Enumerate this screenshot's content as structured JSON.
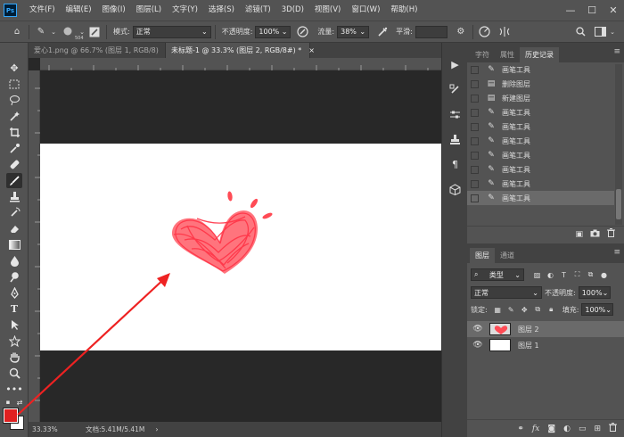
{
  "app": {
    "logo": "Ps"
  },
  "menu": [
    "文件(F)",
    "编辑(E)",
    "图像(I)",
    "图层(L)",
    "文字(Y)",
    "选择(S)",
    "滤镜(T)",
    "3D(D)",
    "视图(V)",
    "窗口(W)",
    "帮助(H)"
  ],
  "window_controls": {
    "minimize": "—",
    "maximize": "☐",
    "close": "✕"
  },
  "options": {
    "brush_size": "504",
    "mode_label": "模式:",
    "mode_value": "正常",
    "opacity_label": "不透明度:",
    "opacity_value": "100%",
    "flow_label": "流量:",
    "flow_value": "38%",
    "smooth_label": "平滑:"
  },
  "doc_tabs": [
    {
      "label": "爱心1.png @ 66.7% (图层 1, RGB/8)",
      "close": "×"
    },
    {
      "label": "未标题-1 @ 33.3% (图层 2, RGB/8#) *",
      "close": "×"
    }
  ],
  "status": {
    "zoom": "33.33%",
    "doc": "文档:5.41M/5.41M",
    "arrow": "›"
  },
  "history_panel": {
    "tabs": [
      "字符",
      "属性",
      "历史记录"
    ],
    "items": [
      "画笔工具",
      "删除图层",
      "新建图层",
      "画笔工具",
      "画笔工具",
      "画笔工具",
      "画笔工具",
      "画笔工具",
      "画笔工具",
      "画笔工具"
    ],
    "item_icons": [
      "brush-icon",
      "doc-icon",
      "doc-icon",
      "brush-icon",
      "brush-icon",
      "brush-icon",
      "brush-icon",
      "brush-icon",
      "brush-icon",
      "brush-icon"
    ]
  },
  "layers_panel": {
    "tabs": [
      "图层",
      "通道"
    ],
    "filter_value": "类型",
    "blend_value": "正常",
    "opacity_label": "不透明度:",
    "opacity_value": "100%",
    "lock_label": "锁定:",
    "fill_label": "填充:",
    "fill_value": "100%",
    "layers": [
      "图层 2",
      "图层 1"
    ]
  },
  "colors": {
    "foreground": "#e02020",
    "background": "#ffffff",
    "heart": "#ff4b55",
    "arrow": "#ee2222"
  }
}
